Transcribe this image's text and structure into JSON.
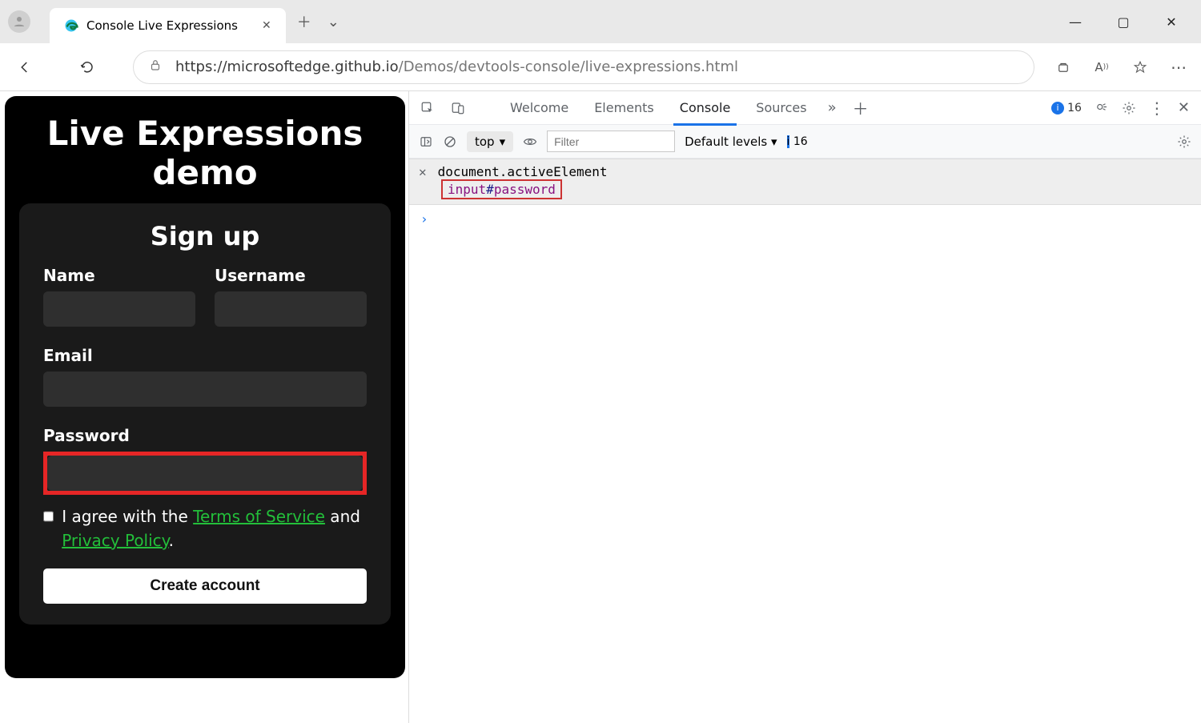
{
  "browser": {
    "tab_title": "Console Live Expressions",
    "url_host": "https://microsoftedge.github.io",
    "url_path": "/Demos/devtools-console/live-expressions.html"
  },
  "page": {
    "title": "Live Expressions demo",
    "form_title": "Sign up",
    "labels": {
      "name": "Name",
      "username": "Username",
      "email": "Email",
      "password": "Password"
    },
    "agree_prefix": "I agree with the ",
    "tos": "Terms of Service",
    "agree_mid": " and ",
    "privacy": "Privacy Policy",
    "agree_suffix": ".",
    "create_btn": "Create account"
  },
  "devtools": {
    "tabs": {
      "welcome": "Welcome",
      "elements": "Elements",
      "console": "Console",
      "sources": "Sources"
    },
    "issues_count": "16",
    "toolbar": {
      "context": "top",
      "filter_placeholder": "Filter",
      "levels": "Default levels",
      "msg_count": "16"
    },
    "live_expression": {
      "expr": "document.activeElement",
      "result": "input#password"
    }
  }
}
